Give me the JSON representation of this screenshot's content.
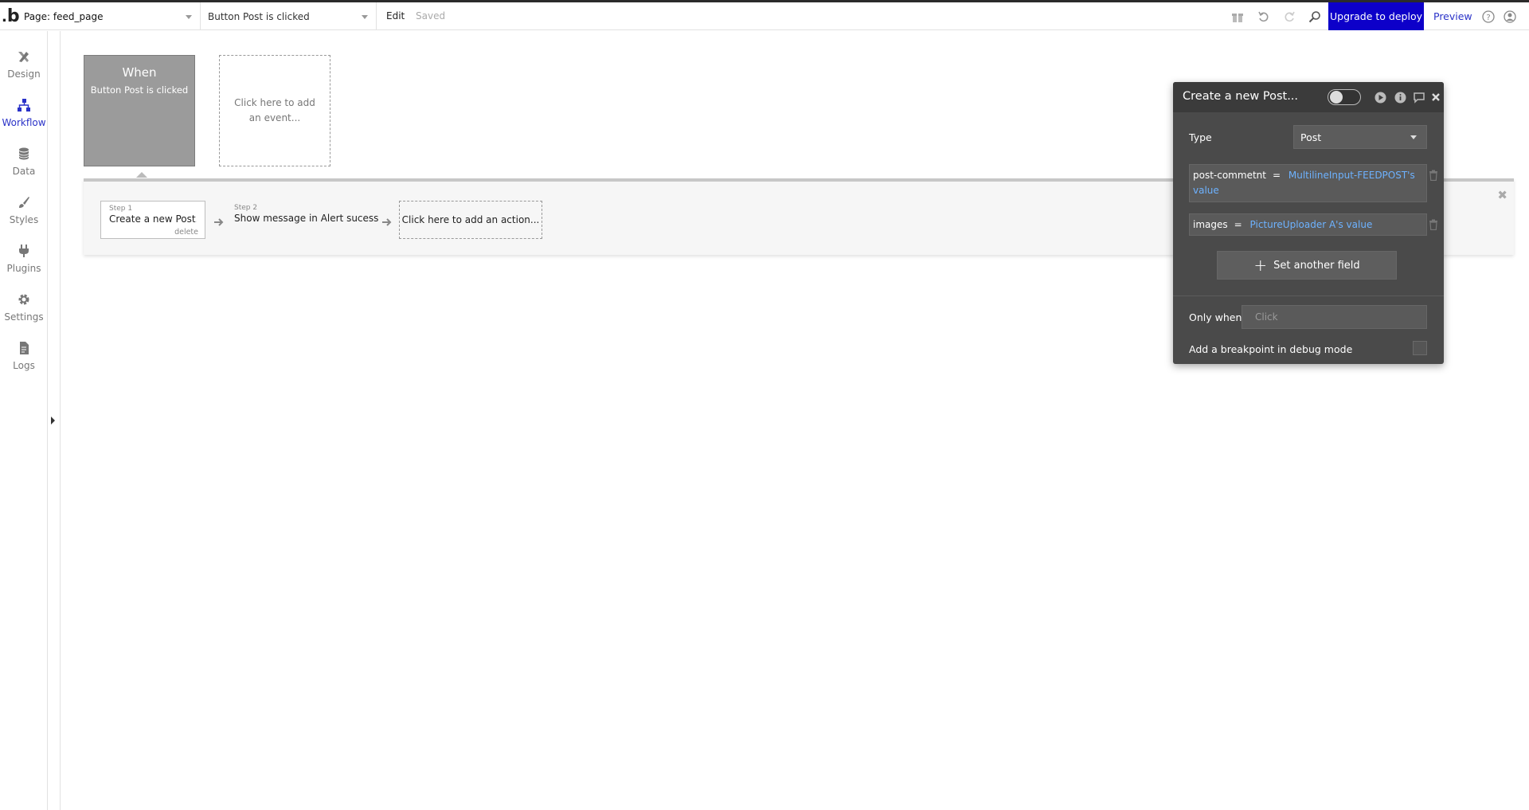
{
  "topbar": {
    "logo": "b",
    "page_selector": "Page: feed_page",
    "workflow_selector": "Button Post is clicked",
    "edit_label": "Edit",
    "saved_label": "Saved",
    "upgrade_label": "Upgrade to deploy",
    "preview_label": "Preview",
    "icons": [
      "gift-icon",
      "undo-icon",
      "redo-icon",
      "search-icon",
      "help-icon",
      "account-icon"
    ]
  },
  "sidebar": {
    "items": [
      {
        "label": "Design",
        "icon": "design-icon"
      },
      {
        "label": "Workflow",
        "icon": "workflow-icon",
        "active": true
      },
      {
        "label": "Data",
        "icon": "database-icon"
      },
      {
        "label": "Styles",
        "icon": "brush-icon"
      },
      {
        "label": "Plugins",
        "icon": "plug-icon"
      },
      {
        "label": "Settings",
        "icon": "gear-icon"
      },
      {
        "label": "Logs",
        "icon": "document-icon"
      }
    ]
  },
  "events": {
    "when_title": "When",
    "when_subtitle": "Button Post is clicked",
    "add_event": "Click here to add an event..."
  },
  "steps": {
    "step1_label": "Step 1",
    "step1_name": "Create a new Post...",
    "step1_delete": "delete",
    "step2_label": "Step 2",
    "step2_name": "Show message in Alert sucess",
    "add_action": "Click here to add an action..."
  },
  "panel": {
    "title": "Create a new Post...",
    "type_label": "Type",
    "type_value": "Post",
    "fields": [
      {
        "name": "post-commetnt",
        "eq": "=",
        "value": "MultilineInput-FEEDPOST's value"
      },
      {
        "name": "images",
        "eq": "=",
        "value": "PictureUploader A's value"
      }
    ],
    "set_another": "Set another field",
    "only_when_label": "Only when",
    "only_when_placeholder": "Click",
    "breakpoint_label": "Add a breakpoint in debug mode"
  },
  "colors": {
    "accent_blue": "#0d00c9",
    "link_blue": "#2a32c8",
    "expression_blue": "#6db2ff",
    "panel_bg": "#4a4a4a"
  }
}
